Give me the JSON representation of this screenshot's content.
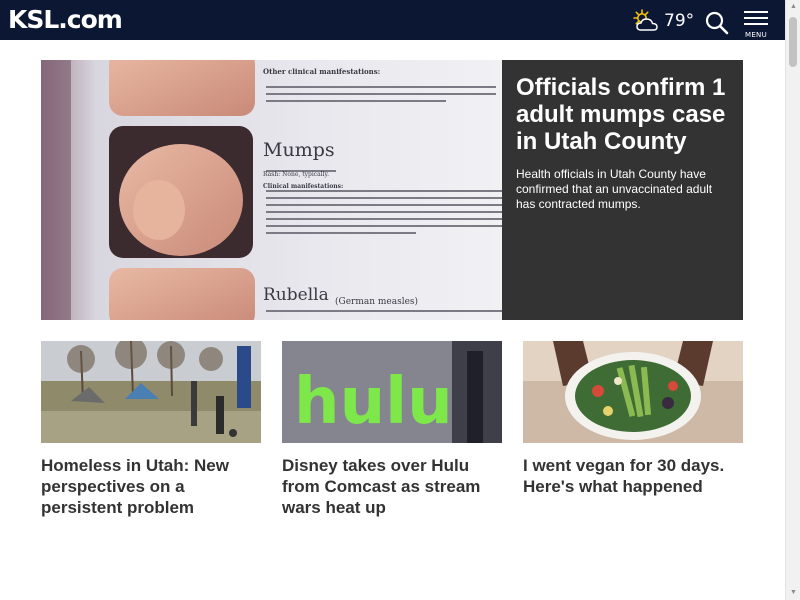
{
  "header": {
    "logo_text": "KSL.com",
    "weather": {
      "temperature": "79°",
      "icon": "partly-sunny-icon"
    },
    "search_icon": "search-icon",
    "menu_label": "MENU"
  },
  "hero": {
    "title": "Officials confirm 1 adult mumps case in Utah County",
    "summary": "Health officials in Utah County have confirmed that an unvaccinated adult has contracted mumps.",
    "image": {
      "clinical_label": "Other clinical manifestations:",
      "heading_1": "Mumps",
      "rash_1": "Rash: None, typically.",
      "clinical_label_2": "Clinical manifestations:",
      "heading_2": "Rubella",
      "heading_2_note": "(German measles)"
    }
  },
  "cards": [
    {
      "title": "Homeless in Utah: New perspectives on a persistent problem"
    },
    {
      "title": "Disney takes over Hulu from Comcast as stream wars heat up",
      "image_text": "hulu"
    },
    {
      "title": "I went vegan for 30 days. Here's what happened"
    }
  ],
  "colors": {
    "header_bg": "#0c1733",
    "hero_panel_bg": "#333333",
    "card_title": "#333333",
    "hulu_green": "#7ee84a"
  }
}
